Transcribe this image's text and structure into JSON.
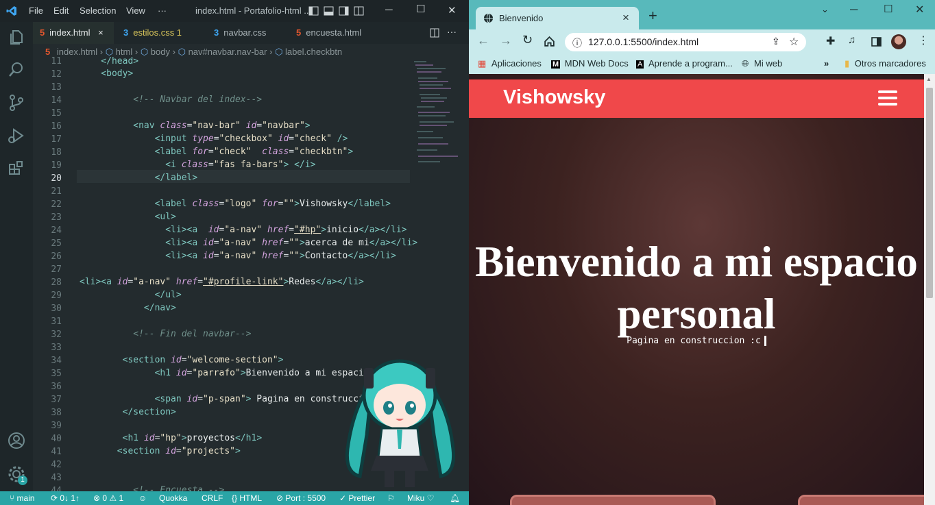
{
  "vscode": {
    "menu": [
      "File",
      "Edit",
      "Selection",
      "View",
      "···"
    ],
    "window_title": "index.html - Portafolio-html ...",
    "tabs": [
      {
        "label": "index.html",
        "close": "×",
        "icon": "html5-icon"
      },
      {
        "label": "estilos.css 1",
        "icon": "css3-icon"
      },
      {
        "label": "navbar.css",
        "icon": "css3-icon"
      },
      {
        "label": "encuesta.html",
        "icon": "html5-icon"
      }
    ],
    "breadcrumb": [
      "index.html",
      "html",
      "body",
      "nav#navbar.nav-bar",
      "label.checkbtn"
    ],
    "line_numbers": [
      "11",
      "12",
      "13",
      "14",
      "15",
      "16",
      "17",
      "18",
      "19",
      "20",
      "21",
      "22",
      "23",
      "24",
      "25",
      "26",
      "27",
      "28",
      "29",
      "30",
      "31",
      "32",
      "33",
      "34",
      "35",
      "36",
      "37",
      "38",
      "39",
      "40",
      "41",
      "42",
      "43",
      "44"
    ],
    "current_line": "20",
    "statusbar": {
      "branch": "main",
      "sync": "0↓ 1↑",
      "problems": "⊗ 0 ⚠ 1",
      "quokka": "Quokka",
      "eol": "CRLF",
      "language": "HTML",
      "port": "Port : 5500",
      "prettier": "Prettier",
      "theme": "Miku"
    },
    "settings_badge": "1",
    "accent_color": "#2aa5a6"
  },
  "chrome": {
    "tab_title": "Bienvenido",
    "tab_close": "×",
    "new_tab": "+",
    "url": "127.0.0.1:5500/index.html",
    "bookmarks": [
      "Aplicaciones",
      "MDN Web Docs",
      "Aprende a program...",
      "Mi web"
    ],
    "overflow": "»",
    "other_bookmarks": "Otros marcadores",
    "frame_color": "#58b9bb"
  },
  "site": {
    "logo": "Vishowsky",
    "hero_title_line1": "Bienvenido a mi espacio",
    "hero_title_line2": "personal",
    "hero_subtitle": "Pagina en construccion :c",
    "nav_color": "#f0484a"
  }
}
